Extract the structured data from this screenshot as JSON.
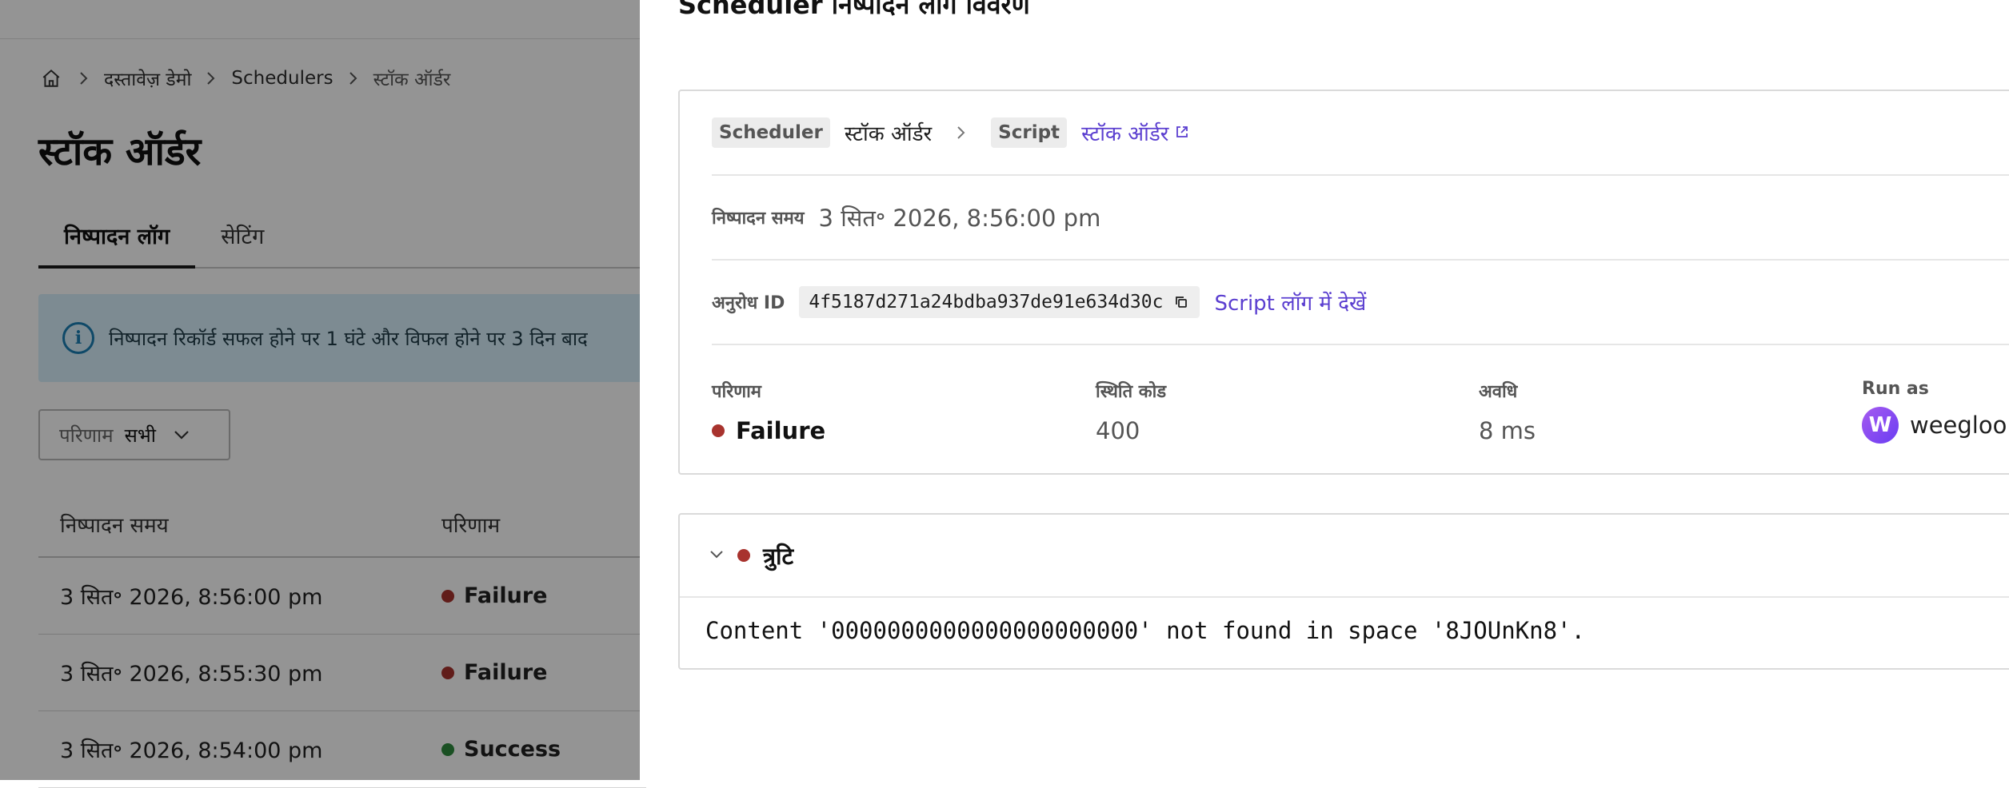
{
  "background": {
    "breadcrumb": [
      "दस्तावेज़ डेमो",
      "Schedulers",
      "स्टॉक ऑर्डर"
    ],
    "title": "स्टॉक ऑर्डर",
    "tabs": [
      "निष्पादन लॉग",
      "सेटिंग"
    ],
    "notice": "निष्पादन रिकॉर्ड सफल होने पर 1 घंटे और विफल होने पर 3 दिन बाद",
    "filter": {
      "label": "परिणाम",
      "value": "सभी"
    },
    "table": {
      "headers": [
        "निष्पादन समय",
        "परिणाम"
      ],
      "rows": [
        {
          "time": "3 सित॰ 2026, 8:56:00 pm",
          "result": "Failure",
          "color": "#a8332e"
        },
        {
          "time": "3 सित॰ 2026, 8:55:30 pm",
          "result": "Failure",
          "color": "#a8332e"
        },
        {
          "time": "3 सित॰ 2026, 8:54:00 pm",
          "result": "Success",
          "color": "#2e8b3d"
        }
      ]
    }
  },
  "drawer": {
    "title": "Scheduler निष्पादन लॉग विवरण",
    "scheduler_tag": "Scheduler",
    "scheduler_name": "स्टॉक ऑर्डर",
    "script_tag": "Script",
    "script_name": "स्टॉक ऑर्डर",
    "time_label": "निष्पादन समय",
    "time_value": "3 सित॰ 2026, 8:56:00 pm",
    "request_label": "अनुरोध ID",
    "request_id": "4f5187d271a24bdba937de91e634d30c",
    "script_log_link": "Script लॉग में देखें",
    "stats": {
      "result_label": "परिणाम",
      "result_value": "Failure",
      "result_color": "#a8332e",
      "status_label": "स्थिति कोड",
      "status_value": "400",
      "duration_label": "अवधि",
      "duration_value": "8 ms",
      "runas_label": "Run as",
      "runas_value": "weegloo",
      "avatar_letter": "W"
    },
    "error": {
      "title": "त्रुटि",
      "message": "Content '0000000000000000000000' not found in space '8JOUnKn8'."
    },
    "accent_color": "#5b3fd0"
  }
}
